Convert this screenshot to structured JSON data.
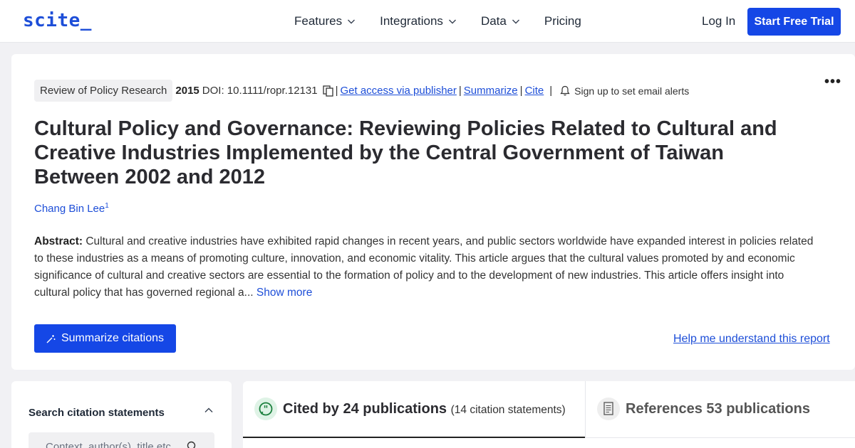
{
  "header": {
    "logo": "scite_",
    "nav": [
      {
        "label": "Features"
      },
      {
        "label": "Integrations"
      },
      {
        "label": "Data"
      },
      {
        "label": "Pricing"
      }
    ],
    "login": "Log In",
    "trial": "Start Free Trial"
  },
  "paper": {
    "journal": "Review of Policy Research",
    "year": "2015",
    "doi": "DOI: 10.1111/ropr.12131",
    "sep": "|",
    "access": "Get access via publisher",
    "summarize": "Summarize",
    "cite": "Cite",
    "alerts": "Sign up to set email alerts",
    "more": "•••",
    "title": "Cultural Policy and Governance: Reviewing Policies Related to Cultural and Creative Industries Implemented by the Central Government of Taiwan Between 2002 and 2012",
    "author": "Chang Bin Lee",
    "author_sup": "1",
    "abstract_label": "Abstract:",
    "abstract": " Cultural and creative industries have exhibited rapid changes in recent years, and public sectors worldwide have expanded interest in policies related to these industries as a means of promoting culture, innovation, and economic vitality. This article argues that the cultural values promoted by and economic significance of cultural and creative sectors are essential to the formation of policy and to the development of new industries. This article offers insight into cultural policy that has governed regional a...",
    "show_more": " Show more",
    "summarize_citations": "Summarize citations",
    "help": "Help me understand this report"
  },
  "sidebar": {
    "title": "Search citation statements",
    "placeholder": "Context, author(s), title etc."
  },
  "tabs": {
    "cited_by": "Cited by 24 publications",
    "cited_statements": "(14 citation statements)",
    "references": "References 53 publications"
  },
  "colors": {
    "accent": "#1547e6",
    "link": "#1d4ed8"
  }
}
